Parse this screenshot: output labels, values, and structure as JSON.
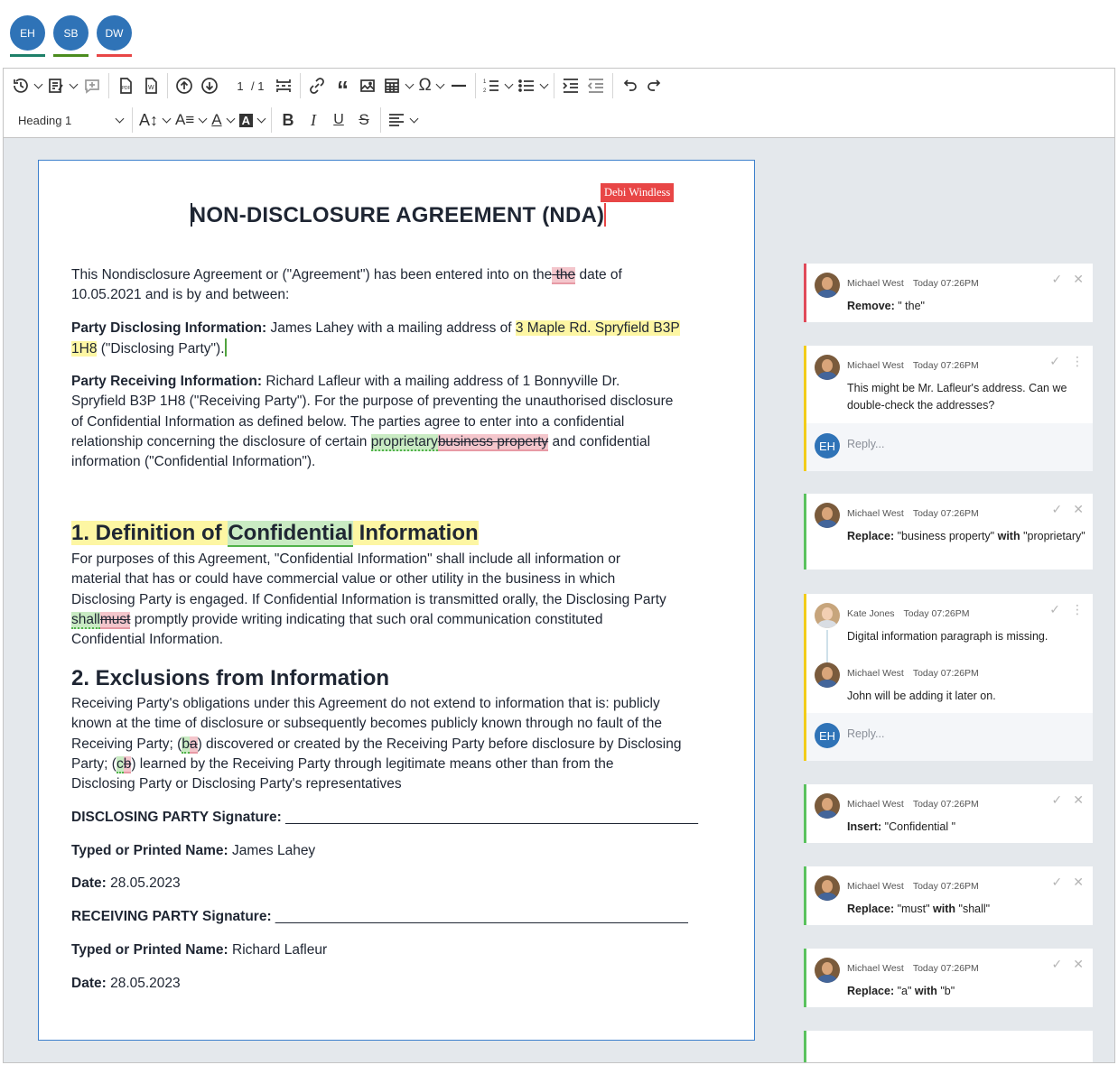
{
  "presence": [
    {
      "initials": "EH",
      "color": "#2f73b7",
      "underline": "#1e8069"
    },
    {
      "initials": "SB",
      "color": "#2f73b7",
      "underline": "#4b8c1e"
    },
    {
      "initials": "DW",
      "color": "#2f73b7",
      "underline": "#e84646"
    }
  ],
  "toolbar": {
    "page_current": "1",
    "page_total": "/ 1",
    "heading_select": "Heading 1",
    "icons": [
      "history-icon",
      "track-changes-icon",
      "comment-icon",
      "export-pdf-icon",
      "export-word-icon",
      "previous-change-icon",
      "next-change-icon",
      "page-break-icon",
      "link-icon",
      "blockquote-icon",
      "image-icon",
      "table-icon",
      "special-characters-icon",
      "horizontal-line-icon",
      "numbered-list-icon",
      "bulleted-list-icon",
      "indent-icon",
      "outdent-icon",
      "undo-icon",
      "redo-icon",
      "font-size-icon",
      "font-family-icon",
      "font-color-icon",
      "font-background-icon",
      "bold-icon",
      "italic-icon",
      "underline-icon",
      "strikethrough-icon",
      "align-icon"
    ]
  },
  "document": {
    "title": "NON-DISCLOSURE AGREEMENT (NDA)",
    "user_flag": "Debi Windless",
    "p1_a": "This Nondisclosure Agreement or (\"Agreement\") has been entered into on the",
    "p1_del": " the",
    "p1_b": " date of",
    "p1_c": "10.05.2021 and is by and between:",
    "p2_label": "Party Disclosing Information:",
    "p2_a": " James Lahey with a mailing address of ",
    "p2_hl1": "3 Maple Rd. Spryfield B3P",
    "p2_hl2": "1H8",
    "p2_b": "  (\"Disclosing Party\").",
    "p3_label": "Party Receiving Information:",
    "p3_a": "  Richard Lafleur with a mailing address of  1 Bonnyville Dr.",
    "p3_b": "Spryfield B3P 1H8 (\"Receiving Party\"). For the purpose of preventing the unauthorised disclosure",
    "p3_c": "of Confidential Information as defined below. The parties agree to enter into a confidential",
    "p3_d": "relationship concerning the disclosure of certain ",
    "p3_ins": "proprietary",
    "p3_del": "business property",
    "p3_e": " and confidential",
    "p3_f": "information (\"Confidential Information\").",
    "h1_a": "1. Definition of ",
    "h1_ins": "Confidential",
    "h1_b": " Information",
    "s1_a": "For purposes of this Agreement, \"Confidential Information\" shall include all information or",
    "s1_b": "material that has or could have commercial value or other utility in the business in which",
    "s1_c": "Disclosing Party is engaged. If Confidential Information is transmitted orally, the Disclosing Party",
    "s1_ins": "shall",
    "s1_del": "must",
    "s1_d": " promptly provide writing indicating that such oral communication constituted",
    "s1_e": "Confidential Information.",
    "h2": "2. Exclusions from Information",
    "s2_a": "Receiving Party's obligations under this Agreement do not extend to information that is: publicly",
    "s2_b": "known at the time of disclosure or subsequently becomes publicly known through no fault of the",
    "s2_c1": "Receiving Party; (",
    "s2_ins1": "b",
    "s2_del1": "a",
    "s2_c2": ") discovered or created by the Receiving Party before disclosure by Disclosing",
    "s2_d1": "Party; (",
    "s2_ins2": "c",
    "s2_del2": "b",
    "s2_d2": ") learned by the Receiving Party through legitimate means other than from the",
    "s2_e": "Disclosing Party or Disclosing Party's representatives",
    "sig1_label": "DISCLOSING PARTY Signature:",
    "sig1_line": " _____________________________________________________",
    "name1_label": "Typed or Printed Name:",
    "name1_val": " James Lahey",
    "date1_label": "Date:",
    "date1_val": " 28.05.2023",
    "sig2_label": "RECEIVING PARTY Signature:",
    "sig2_line": " _____________________________________________________",
    "name2_label": "Typed or Printed Name:",
    "name2_val": " Richard Lafleur",
    "date2_label": "Date:",
    "date2_val": " 28.05.2023"
  },
  "comments": [
    {
      "author": "Michael West",
      "time": "Today 07:26PM",
      "label": "Remove:",
      "text": " \" the\""
    },
    {
      "author": "Michael West",
      "time": "Today 07:26PM",
      "text": "This might be Mr. Lafleur's address. Can we double-check the addresses?",
      "reply_initials": "EH",
      "reply_placeholder": "Reply..."
    },
    {
      "author": "Michael West",
      "time": "Today 07:26PM",
      "label": "Replace:",
      "text": " \"business property\" ",
      "label2": "with",
      "text2": " \"proprietary\""
    },
    {
      "author": "Kate Jones",
      "time": "Today 07:26PM",
      "text": "Digital information paragraph is missing.",
      "reply_author": "Michael West",
      "reply_time": "Today 07:26PM",
      "reply_text": "John will be adding it later on.",
      "reply_initials": "EH",
      "reply_placeholder": "Reply..."
    },
    {
      "author": "Michael West",
      "time": "Today 07:26PM",
      "label": "Insert:",
      "text": " \"Confidential \""
    },
    {
      "author": "Michael West",
      "time": "Today 07:26PM",
      "label": "Replace:",
      "text": " \"must\" ",
      "label2": "with",
      "text2": " \"shall\""
    },
    {
      "author": "Michael West",
      "time": "Today 07:26PM",
      "label": "Replace:",
      "text": " \"a\" ",
      "label2": "with",
      "text2": " \"b\""
    }
  ],
  "colors": {
    "accent": "#2f73b7",
    "delete": "#f4c6cc",
    "insert": "#c9ebc3",
    "highlight": "#fdf6a3",
    "comment_red": "#e04a5a",
    "comment_yellow": "#f2cc1a",
    "comment_green": "#5ac25e"
  }
}
